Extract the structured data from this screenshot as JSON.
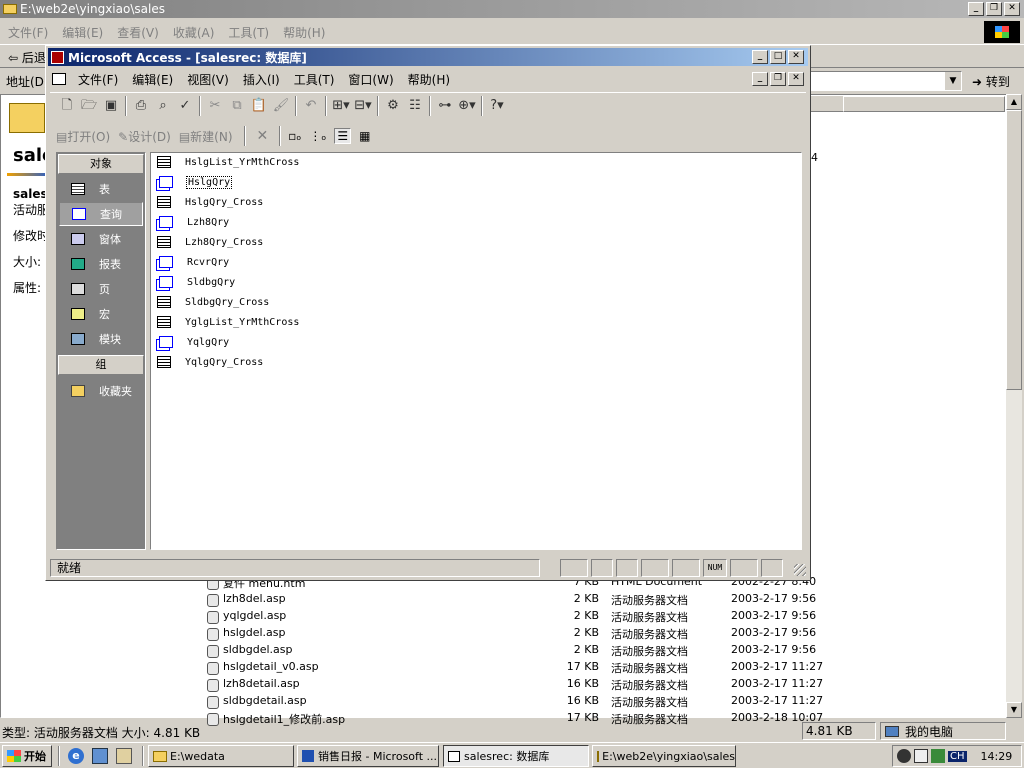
{
  "explorer": {
    "title": "E:\\web2e\\yingxiao\\sales",
    "menu": [
      "文件(F)",
      "编辑(E)",
      "查看(V)",
      "收藏(A)",
      "工具(T)",
      "帮助(H)"
    ],
    "back_label": "后退",
    "address_label": "地址(D)",
    "go_label": "转到",
    "folder_heading": "sale",
    "info_lines": [
      "sales",
      "活动服",
      "修改时",
      "大小:",
      "属性:"
    ],
    "partial_size": "4",
    "files": [
      {
        "name": "复件 menu.htm",
        "size": "7 KB",
        "type": "HTML Document",
        "date": "2002-2-27 8:40"
      },
      {
        "name": "lzh8del.asp",
        "size": "2 KB",
        "type": "活动服务器文档",
        "date": "2003-2-17 9:56"
      },
      {
        "name": "yqlgdel.asp",
        "size": "2 KB",
        "type": "活动服务器文档",
        "date": "2003-2-17 9:56"
      },
      {
        "name": "hslgdel.asp",
        "size": "2 KB",
        "type": "活动服务器文档",
        "date": "2003-2-17 9:56"
      },
      {
        "name": "sldbgdel.asp",
        "size": "2 KB",
        "type": "活动服务器文档",
        "date": "2003-2-17 9:56"
      },
      {
        "name": "hslgdetail_v0.asp",
        "size": "17 KB",
        "type": "活动服务器文档",
        "date": "2003-2-17 11:27"
      },
      {
        "name": "lzh8detail.asp",
        "size": "16 KB",
        "type": "活动服务器文档",
        "date": "2003-2-17 11:27"
      },
      {
        "name": "sldbgdetail.asp",
        "size": "16 KB",
        "type": "活动服务器文档",
        "date": "2003-2-17 11:27"
      },
      {
        "name": "hslgdetail1_修改前.asp",
        "size": "17 KB",
        "type": "活动服务器文档",
        "date": "2003-2-18 10:07"
      }
    ],
    "status_type": "类型: 活动服务器文档 大小: 4.81 KB",
    "status_size": "4.81 KB",
    "status_computer": "我的电脑"
  },
  "access": {
    "title": "Microsoft Access - [salesrec: 数据库]",
    "menu": [
      "文件(F)",
      "编辑(E)",
      "视图(V)",
      "插入(I)",
      "工具(T)",
      "窗口(W)",
      "帮助(H)"
    ],
    "db_toolbar": {
      "open": "打开(O)",
      "design": "设计(D)",
      "new": "新建(N)"
    },
    "sidebar_header": "对象",
    "objects": [
      "表",
      "查询",
      "窗体",
      "报表",
      "页",
      "宏",
      "模块"
    ],
    "selected_object": "查询",
    "groups_header": "组",
    "groups": [
      "收藏夹"
    ],
    "items": [
      {
        "name": "HslgList_YrMthCross",
        "kind": "table"
      },
      {
        "name": "HslgQry",
        "kind": "query"
      },
      {
        "name": "HslgQry_Cross",
        "kind": "table"
      },
      {
        "name": "Lzh8Qry",
        "kind": "query"
      },
      {
        "name": "Lzh8Qry_Cross",
        "kind": "table"
      },
      {
        "name": "RcvrQry",
        "kind": "query"
      },
      {
        "name": "SldbgQry",
        "kind": "query"
      },
      {
        "name": "SldbgQry_Cross",
        "kind": "table"
      },
      {
        "name": "YglgList_YrMthCross",
        "kind": "table"
      },
      {
        "name": "YqlgQry",
        "kind": "query"
      },
      {
        "name": "YqlgQry_Cross",
        "kind": "table"
      }
    ],
    "selected_item": "HslgQry",
    "status": "就绪",
    "num": "NUM"
  },
  "taskbar": {
    "start": "开始",
    "tasks": [
      "E:\\wedata",
      "销售日报 - Microsoft ...",
      "salesrec: 数据库",
      "E:\\web2e\\yingxiao\\sales"
    ],
    "active_task": "salesrec: 数据库",
    "lang": "CH",
    "clock": "14:29"
  }
}
